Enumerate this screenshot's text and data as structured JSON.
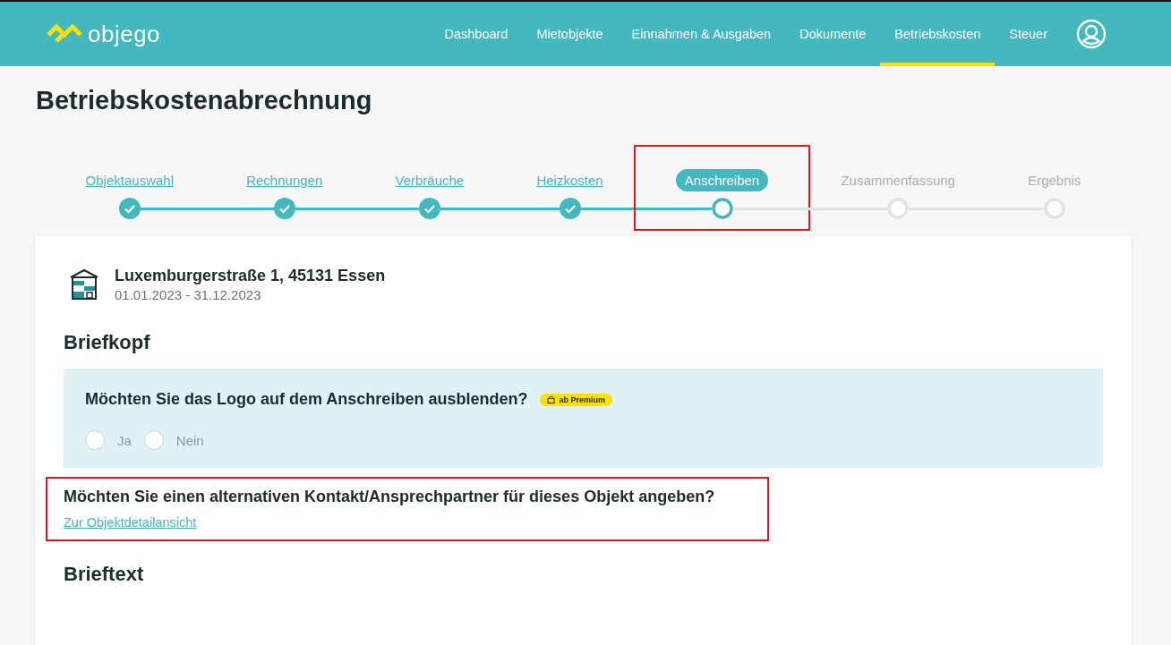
{
  "nav": {
    "brand": "objego",
    "items": [
      {
        "label": "Dashboard",
        "selected": false
      },
      {
        "label": "Mietobjekte",
        "selected": false
      },
      {
        "label": "Einnahmen & Ausgaben",
        "selected": false
      },
      {
        "label": "Dokumente",
        "selected": false
      },
      {
        "label": "Betriebskosten",
        "selected": true
      },
      {
        "label": "Steuer",
        "selected": false
      }
    ]
  },
  "title": "Betriebskostenabrechnung",
  "steps": [
    {
      "label": "Objektauswahl",
      "kind": "done",
      "highlighted": false
    },
    {
      "label": "Rechnungen",
      "kind": "done",
      "highlighted": false
    },
    {
      "label": "Verbräuche",
      "kind": "done",
      "highlighted": false
    },
    {
      "label": "Heizkosten",
      "kind": "done",
      "highlighted": false
    },
    {
      "label": "Anschreiben",
      "kind": "current",
      "highlighted": true
    },
    {
      "label": "Zusammenfassung",
      "kind": "pending",
      "highlighted": false
    },
    {
      "label": "Ergebnis",
      "kind": "pending",
      "highlighted": false
    }
  ],
  "property": {
    "address": "Luxemburgerstraße 1, 45131 Essen",
    "period": "01.01.2023 - 31.12.2023"
  },
  "letterhead": {
    "heading": "Briefkopf",
    "question": "Möchten Sie das Logo auf dem Anschreiben ausblenden?",
    "badge": "ab Premium",
    "options": [
      {
        "label": "Ja",
        "selected": false,
        "disabled": true
      },
      {
        "label": "Nein",
        "selected": false,
        "disabled": true
      }
    ]
  },
  "contact": {
    "question": "Möchten Sie einen alternativen Kontakt/Ansprechpartner für dieses Objekt angeben?",
    "link": "Zur Objektdetailansicht",
    "highlighted": true
  },
  "letter_text": {
    "heading": "Brieftext"
  }
}
